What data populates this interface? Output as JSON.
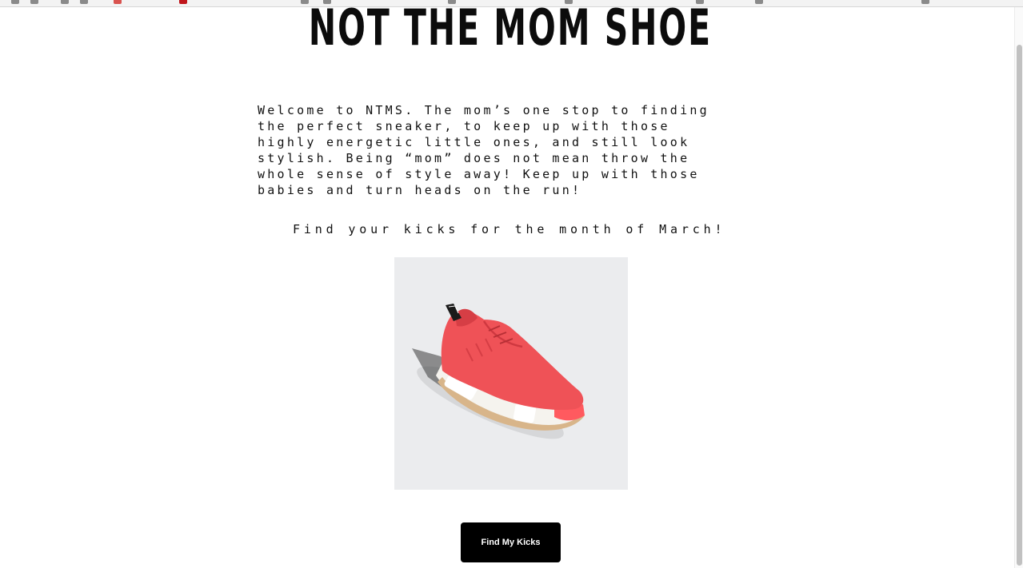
{
  "header": {
    "title": "NOT THE MOM SHOE"
  },
  "intro": {
    "lines": [
      "Welcome to NTMS. The mom’s one stop to finding",
      "the perfect sneaker, to keep up with those",
      "highly energetic little ones, and still look",
      "stylish. Being “mom” does not mean throw the",
      "whole sense of style away! Keep up with those",
      "babies and turn heads on the run!"
    ]
  },
  "promo": {
    "text": "Find your kicks for the month of March!"
  },
  "product": {
    "image_icon": "coral-sneaker-image",
    "background": "#ebecee",
    "shoe_color": "#ef5257"
  },
  "cta": {
    "label": "Find My Kicks"
  },
  "colors": {
    "text": "#0c0c0c",
    "button_bg": "#000000",
    "button_text": "#ffffff"
  }
}
